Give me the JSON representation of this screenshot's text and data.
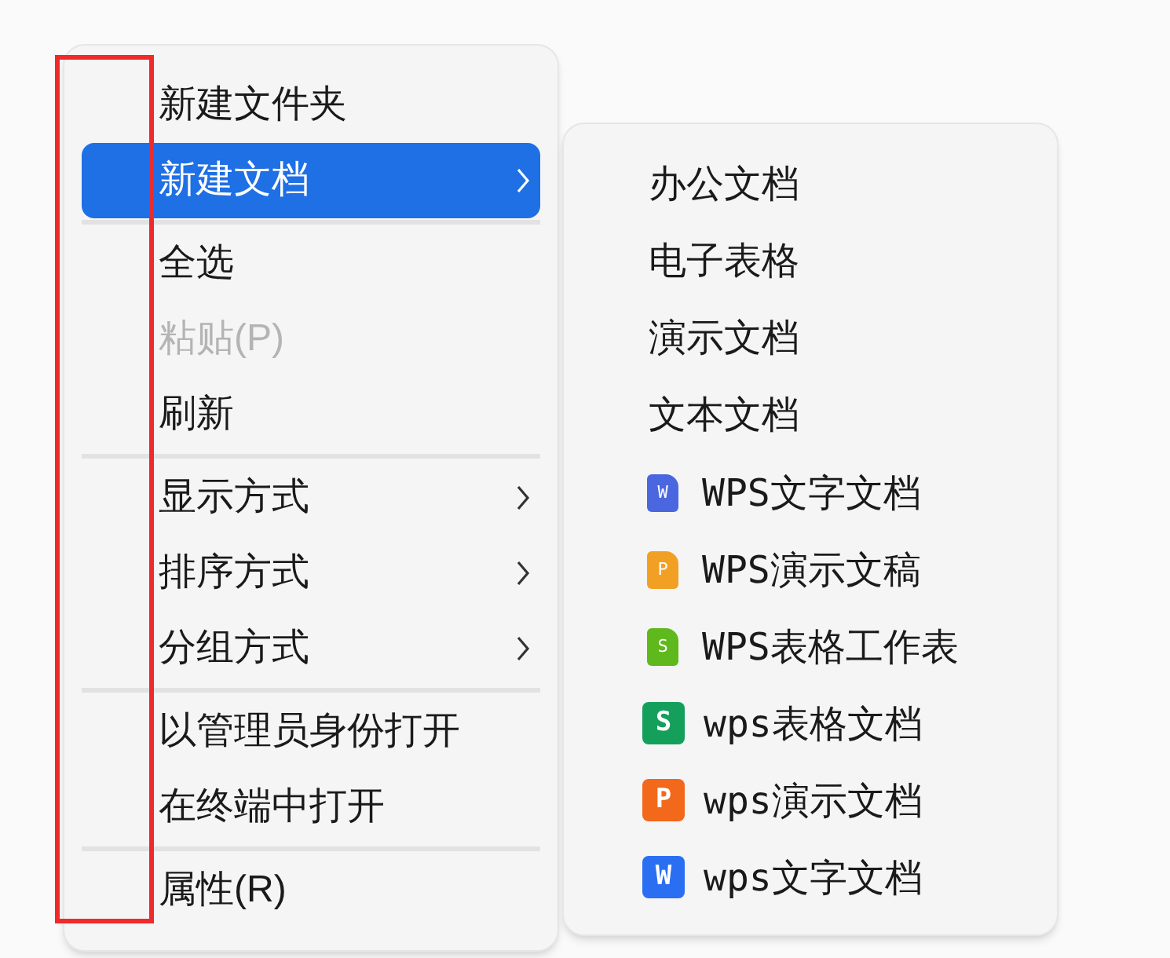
{
  "menu": {
    "items": [
      {
        "kind": "item",
        "label": "新建文件夹",
        "disabled": false,
        "selected": false,
        "submenu": false
      },
      {
        "kind": "item",
        "label": "新建文档",
        "disabled": false,
        "selected": true,
        "submenu": true
      },
      {
        "kind": "separator"
      },
      {
        "kind": "item",
        "label": "全选",
        "disabled": false,
        "selected": false,
        "submenu": false
      },
      {
        "kind": "item",
        "label": "粘贴(P)",
        "disabled": true,
        "selected": false,
        "submenu": false
      },
      {
        "kind": "item",
        "label": "刷新",
        "disabled": false,
        "selected": false,
        "submenu": false
      },
      {
        "kind": "separator"
      },
      {
        "kind": "item",
        "label": "显示方式",
        "disabled": false,
        "selected": false,
        "submenu": true
      },
      {
        "kind": "item",
        "label": "排序方式",
        "disabled": false,
        "selected": false,
        "submenu": true
      },
      {
        "kind": "item",
        "label": "分组方式",
        "disabled": false,
        "selected": false,
        "submenu": true
      },
      {
        "kind": "separator"
      },
      {
        "kind": "item",
        "label": "以管理员身份打开",
        "disabled": false,
        "selected": false,
        "submenu": false
      },
      {
        "kind": "item",
        "label": "在终端中打开",
        "disabled": false,
        "selected": false,
        "submenu": false
      },
      {
        "kind": "separator"
      },
      {
        "kind": "item",
        "label": "属性(R)",
        "disabled": false,
        "selected": false,
        "submenu": false
      }
    ]
  },
  "submenu": {
    "items": [
      {
        "kind": "plain",
        "label": "办公文档"
      },
      {
        "kind": "plain",
        "label": "电子表格"
      },
      {
        "kind": "plain",
        "label": "演示文档"
      },
      {
        "kind": "plain",
        "label": "文本文档"
      },
      {
        "kind": "page",
        "label": "WPS文字文档",
        "badge": "W",
        "color": "#4a67e0"
      },
      {
        "kind": "page",
        "label": "WPS演示文稿",
        "badge": "P",
        "color": "#f2a024"
      },
      {
        "kind": "page",
        "label": "WPS表格工作表",
        "badge": "S",
        "color": "#5fb81c"
      },
      {
        "kind": "tile",
        "label": "wps表格文档",
        "badge": "S",
        "color": "#14a05a"
      },
      {
        "kind": "tile",
        "label": "wps演示文档",
        "badge": "P",
        "color": "#f2691c"
      },
      {
        "kind": "tile",
        "label": "wps文字文档",
        "badge": "W",
        "color": "#2a6ff2"
      }
    ]
  },
  "annotation": {
    "kind": "frame"
  }
}
